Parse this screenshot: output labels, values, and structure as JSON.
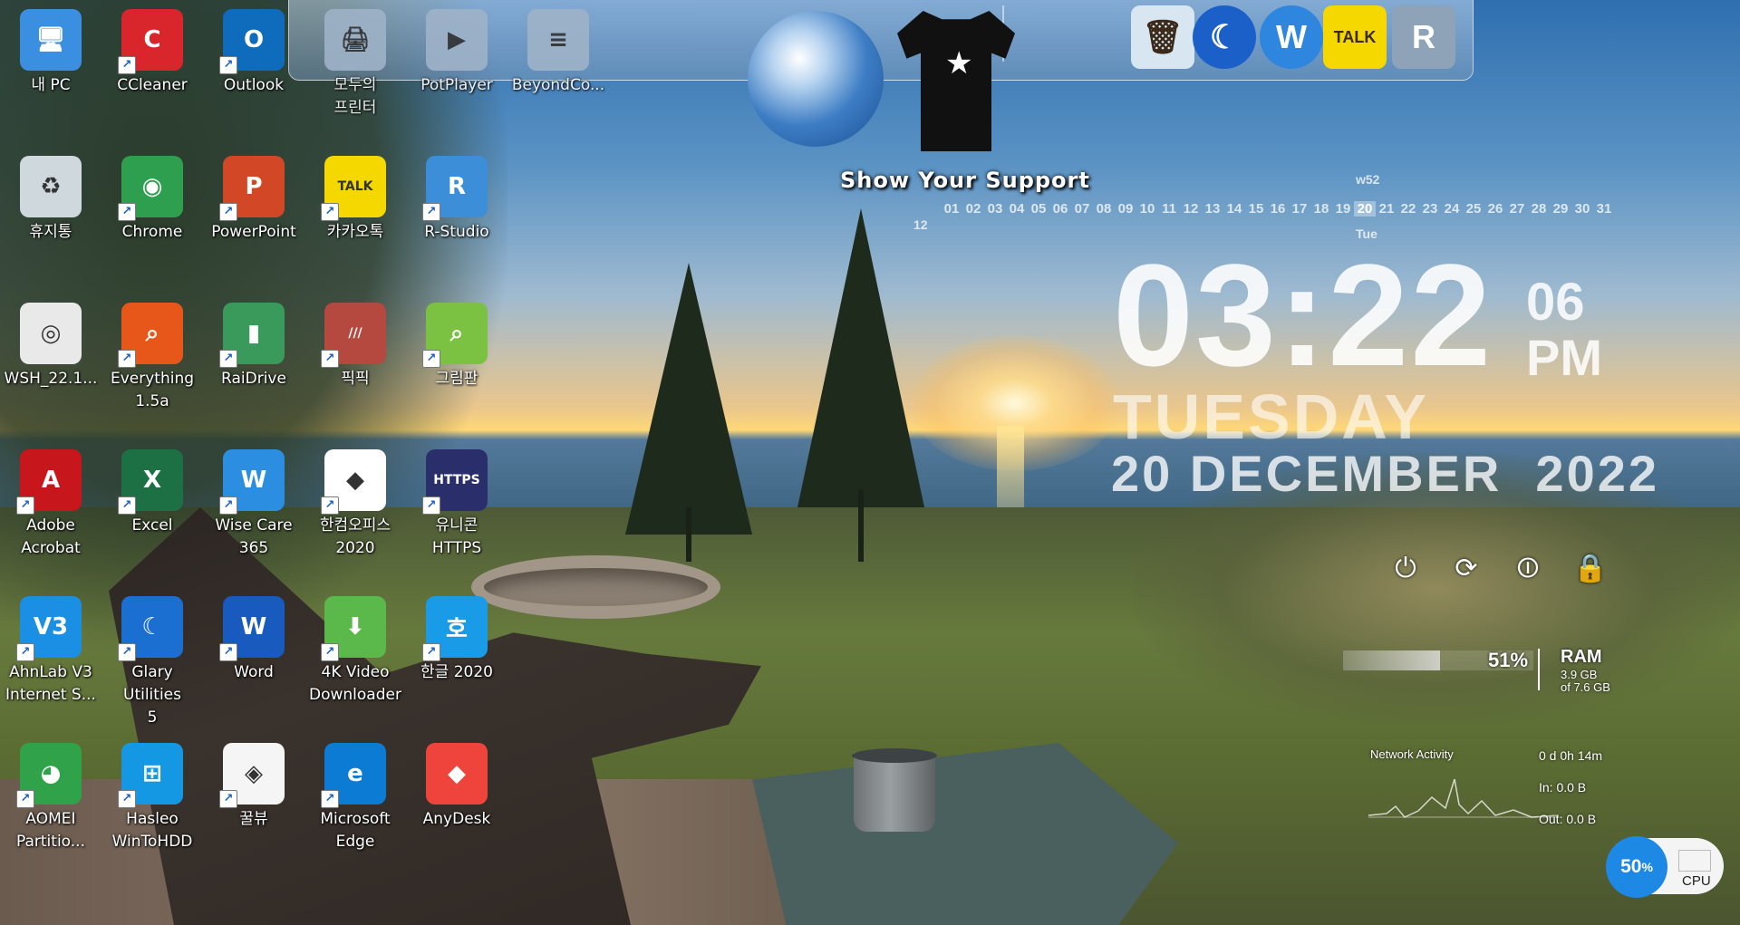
{
  "desktop": {
    "icons": [
      {
        "label": "내 PC",
        "icon": "this-pc-icon",
        "color": "#3a8fe0",
        "glyph": "🖥",
        "shortcut": false
      },
      {
        "label": "CCleaner",
        "icon": "ccleaner-icon",
        "color": "#d8262c",
        "glyph": "C",
        "shortcut": true
      },
      {
        "label": "Outlook",
        "icon": "outlook-icon",
        "color": "#0f6cbd",
        "glyph": "O",
        "shortcut": true
      },
      {
        "label": "모두의\n프린터",
        "icon": "printer-icon",
        "color": "#9fb3c8",
        "glyph": "🖨",
        "shortcut": false
      },
      {
        "label": "PotPlayer",
        "icon": "potplayer-icon",
        "color": "#9fb3c8",
        "glyph": "▶",
        "shortcut": false
      },
      {
        "label": "BeyondCo...",
        "icon": "beyondcompare-icon",
        "color": "#9fb3c8",
        "glyph": "≡",
        "shortcut": false
      },
      {
        "label": "휴지통",
        "icon": "recycle-bin-icon",
        "color": "#cfd8dc",
        "glyph": "♻",
        "shortcut": false
      },
      {
        "label": "Chrome",
        "icon": "chrome-icon",
        "color": "#2e9e4f",
        "glyph": "◉",
        "shortcut": true
      },
      {
        "label": "PowerPoint",
        "icon": "powerpoint-icon",
        "color": "#d24726",
        "glyph": "P",
        "shortcut": true
      },
      {
        "label": "카카오톡",
        "icon": "kakaotalk-icon",
        "color": "#f5d800",
        "glyph": "TALK",
        "shortcut": true
      },
      {
        "label": "R-Studio",
        "icon": "r-studio-icon",
        "color": "#3d8ed8",
        "glyph": "R",
        "shortcut": true
      },
      {
        "label": "WSH_22.1...",
        "icon": "disc-image-icon",
        "color": "#e9e9e9",
        "glyph": "◎",
        "shortcut": false
      },
      {
        "label": "Everything\n1.5a",
        "icon": "everything-icon",
        "color": "#e8571a",
        "glyph": "⌕",
        "shortcut": true
      },
      {
        "label": "RaiDrive",
        "icon": "raidrive-icon",
        "color": "#3a9a5c",
        "glyph": "▮",
        "shortcut": true
      },
      {
        "label": "픽픽",
        "icon": "picpick-icon",
        "color": "#b5483f",
        "glyph": "///",
        "shortcut": true
      },
      {
        "label": "그림판",
        "icon": "paint-icon",
        "color": "#7bc142",
        "glyph": "⌕",
        "shortcut": true
      },
      {
        "label": "Adobe\nAcrobat",
        "icon": "acrobat-icon",
        "color": "#c8161d",
        "glyph": "A",
        "shortcut": true
      },
      {
        "label": "Excel",
        "icon": "excel-icon",
        "color": "#1d7044",
        "glyph": "X",
        "shortcut": true
      },
      {
        "label": "Wise Care\n365",
        "icon": "wise-care-icon",
        "color": "#2c8ee0",
        "glyph": "W",
        "shortcut": true
      },
      {
        "label": "한컴오피스\n2020",
        "icon": "hancom-office-icon",
        "color": "#ffffff",
        "glyph": "◆",
        "shortcut": true
      },
      {
        "label": "유니콘\nHTTPS",
        "icon": "unicorn-https-icon",
        "color": "#2a2f6b",
        "glyph": "HTTPS",
        "shortcut": true
      },
      {
        "label": "AhnLab V3\nInternet S...",
        "icon": "ahnlab-v3-icon",
        "color": "#1a8fe3",
        "glyph": "V3",
        "shortcut": true
      },
      {
        "label": "Glary Utilities\n5",
        "icon": "glary-utilities-icon",
        "color": "#1a6fd0",
        "glyph": "☾",
        "shortcut": true
      },
      {
        "label": "Word",
        "icon": "word-icon",
        "color": "#185abd",
        "glyph": "W",
        "shortcut": true
      },
      {
        "label": "4K Video\nDownloader",
        "icon": "4k-video-downloader-icon",
        "color": "#5bb94c",
        "glyph": "⬇",
        "shortcut": true
      },
      {
        "label": "한글 2020",
        "icon": "hangul-icon",
        "color": "#1a9be8",
        "glyph": "호",
        "shortcut": true
      },
      {
        "label": "AOMEI\nPartitio...",
        "icon": "aomei-partition-icon",
        "color": "#2fa24a",
        "glyph": "◕",
        "shortcut": true
      },
      {
        "label": "Hasleo\nWinToHDD",
        "icon": "hasleo-icon",
        "color": "#1598e3",
        "glyph": "⊞",
        "shortcut": true
      },
      {
        "label": "꿀뷰",
        "icon": "honeyview-icon",
        "color": "#f5f5f5",
        "glyph": "◈",
        "shortcut": true
      },
      {
        "label": "Microsoft\nEdge",
        "icon": "edge-icon",
        "color": "#0c7bd4",
        "glyph": "e",
        "shortcut": true
      },
      {
        "label": "AnyDesk",
        "icon": "anydesk-icon",
        "color": "#ef443b",
        "glyph": "◆",
        "shortcut": false
      }
    ]
  },
  "dock": {
    "items": [
      {
        "icon": "recycle-bin-icon",
        "glyph": "🗑",
        "color": "#d8e6f2"
      },
      {
        "icon": "glary-moon-icon",
        "glyph": "☾",
        "color": "#1b60c9"
      },
      {
        "icon": "wise-shield-icon",
        "glyph": "W",
        "color": "#2e86de"
      },
      {
        "icon": "kakaotalk-icon",
        "glyph": "TALK",
        "color": "#f5d800"
      },
      {
        "icon": "r-studio-icon",
        "glyph": "R",
        "color": "#8ea3b8"
      }
    ]
  },
  "support": {
    "label": "Show Your Support"
  },
  "calendar": {
    "week": "w52",
    "month": "12",
    "weekday": "Tue",
    "days": [
      "01",
      "02",
      "03",
      "04",
      "05",
      "06",
      "07",
      "08",
      "09",
      "10",
      "11",
      "12",
      "13",
      "14",
      "15",
      "16",
      "17",
      "18",
      "19",
      "20",
      "21",
      "22",
      "23",
      "24",
      "25",
      "26",
      "27",
      "28",
      "29",
      "30",
      "31"
    ],
    "today": "20"
  },
  "clock": {
    "time": "03:22",
    "seconds": "06",
    "ampm": "PM",
    "day": "TUESDAY",
    "date": "20 DECEMBER  2022"
  },
  "power": [
    {
      "icon": "power-icon",
      "glyph": "⏻"
    },
    {
      "icon": "restart-icon",
      "glyph": "⟳"
    },
    {
      "icon": "sleep-icon",
      "glyph": "⏼"
    },
    {
      "icon": "lock-icon",
      "glyph": "🔒"
    }
  ],
  "ram": {
    "percent": "51%",
    "title": "RAM",
    "used": "3.9 GB",
    "total": "of 7.6 GB",
    "level": 0.51
  },
  "network": {
    "title": "Network Activity",
    "uptime": "0 d 0h 14m",
    "in": "In: 0.0 B",
    "out": "Out: 0.0 B"
  },
  "cpu": {
    "percent": "50",
    "unit": "%",
    "label": "CPU"
  }
}
